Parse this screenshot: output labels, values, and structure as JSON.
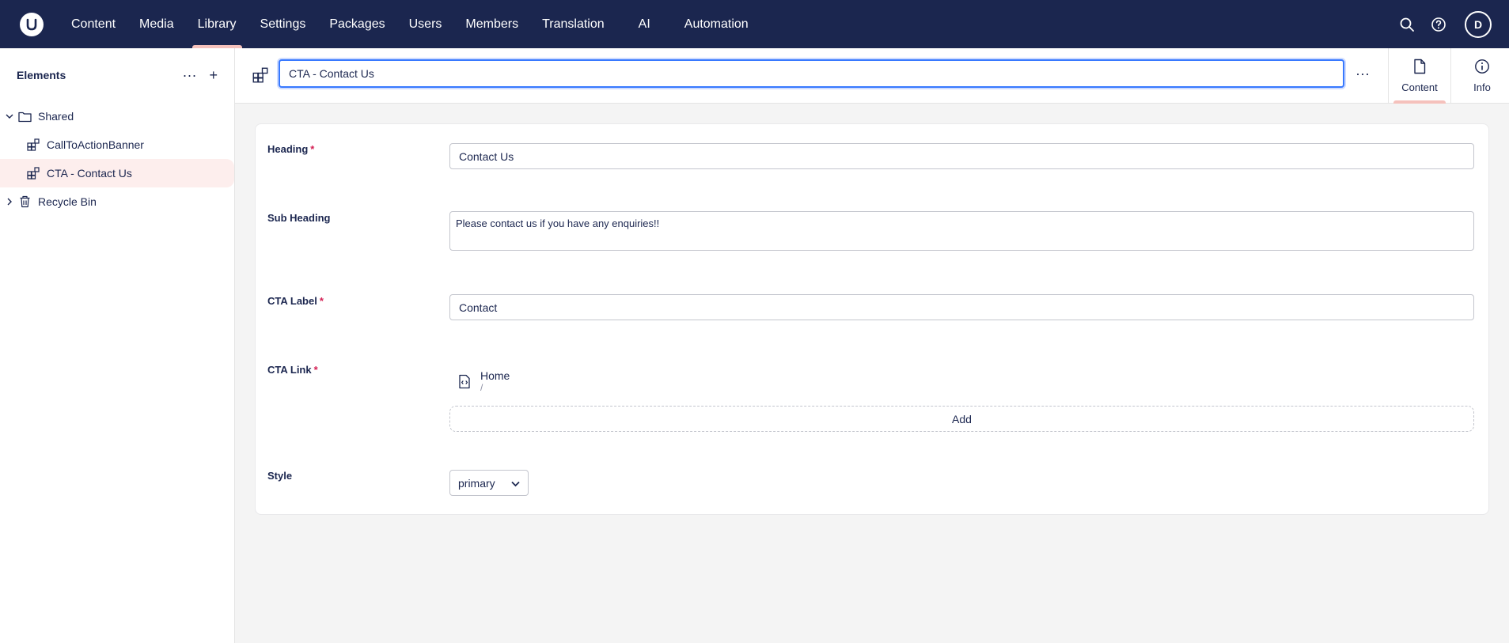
{
  "nav": {
    "items": [
      {
        "label": "Content"
      },
      {
        "label": "Media"
      },
      {
        "label": "Library"
      },
      {
        "label": "Settings"
      },
      {
        "label": "Packages"
      },
      {
        "label": "Users"
      },
      {
        "label": "Members"
      },
      {
        "label": "Translation"
      },
      {
        "label": "AI"
      },
      {
        "label": "Automation"
      }
    ],
    "active": "Library",
    "avatar_initial": "D"
  },
  "sidebar": {
    "title": "Elements",
    "more_label": "···",
    "add_label": "+",
    "tree": [
      {
        "label": "Shared",
        "icon": "folder-icon",
        "expanded": true
      },
      {
        "label": "CallToActionBanner",
        "icon": "element-icon"
      },
      {
        "label": "CTA - Contact Us",
        "icon": "element-icon",
        "active": true
      },
      {
        "label": "Recycle Bin",
        "icon": "trash-icon",
        "expanded": false
      }
    ]
  },
  "header": {
    "name_value": "CTA - Contact Us",
    "more_label": "···",
    "tabs": [
      {
        "label": "Content",
        "icon": "document-icon",
        "active": true
      },
      {
        "label": "Info",
        "icon": "info-icon"
      }
    ]
  },
  "form": {
    "heading": {
      "label": "Heading",
      "required": "*",
      "value": "Contact Us"
    },
    "sub_heading": {
      "label": "Sub Heading",
      "value": "Please contact us if you have any enquiries!!"
    },
    "cta_label": {
      "label": "CTA Label",
      "required": "*",
      "value": "Contact"
    },
    "cta_link": {
      "label": "CTA Link",
      "required": "*",
      "link_name": "Home",
      "link_url": "/",
      "add_label": "Add"
    },
    "style": {
      "label": "Style",
      "value": "primary"
    }
  },
  "colors": {
    "topbar": "#1b264f",
    "accent": "#f5c1bc",
    "focus": "#3879ff",
    "required": "#d42054"
  }
}
